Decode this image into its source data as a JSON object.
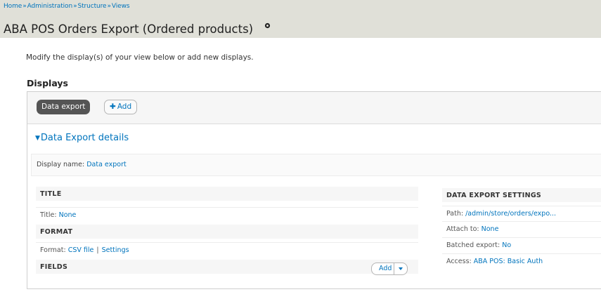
{
  "breadcrumb": {
    "items": [
      "Home",
      "Administration",
      "Structure",
      "Views"
    ],
    "separator": "»"
  },
  "page": {
    "title": "ABA POS Orders Export (Ordered products)",
    "intro": "Modify the display(s) of your view below or add new displays."
  },
  "displays": {
    "heading": "Displays",
    "active_tab": "Data export",
    "add_plus": "✚",
    "add_label": "Add"
  },
  "details": {
    "arrow": "▼",
    "title": "Data Export details",
    "display_name_label": "Display name:",
    "display_name_value": "Data export"
  },
  "left": {
    "title_head": "TITLE",
    "title_label": "Title:",
    "title_value": "None",
    "format_head": "FORMAT",
    "format_label": "Format:",
    "format_value": "CSV file",
    "format_pipe": "|",
    "format_settings": "Settings",
    "fields_head": "FIELDS",
    "fields_add": "Add"
  },
  "right": {
    "head": "DATA EXPORT SETTINGS",
    "path_label": "Path:",
    "path_value": "/admin/store/orders/expo...",
    "attach_label": "Attach to:",
    "attach_value": "None",
    "batched_label": "Batched export:",
    "batched_value": "No",
    "access_label": "Access:",
    "access_value": "ABA POS: Basic Auth"
  },
  "colors": {
    "link": "#0074bd",
    "header_bg": "#e0e0d8",
    "active_tab_bg": "#555555"
  }
}
